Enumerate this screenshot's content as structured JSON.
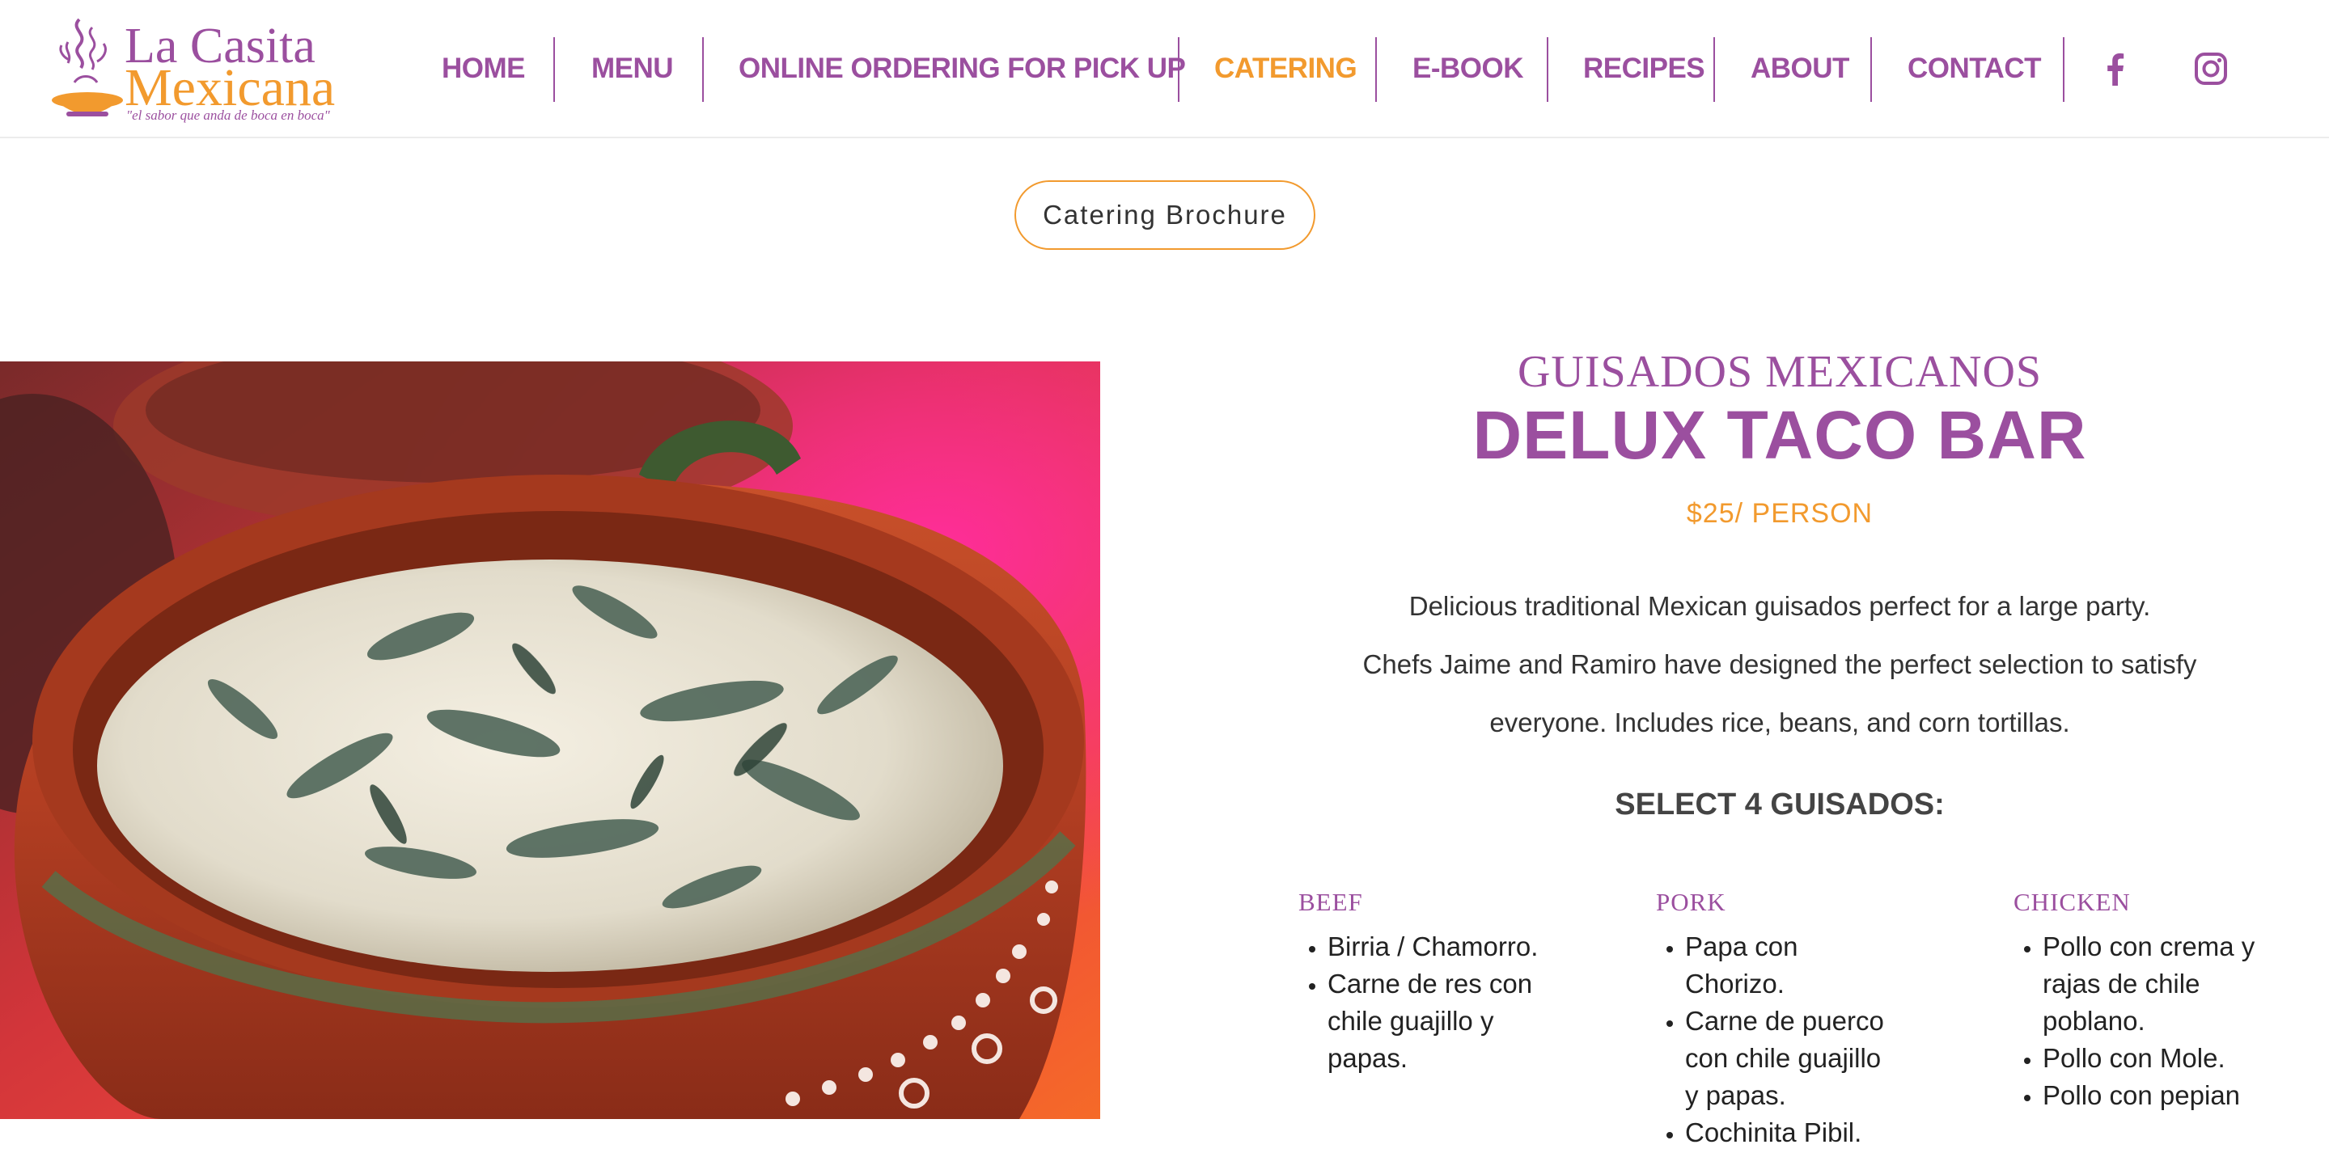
{
  "brand": {
    "name_line1": "La Casita",
    "name_line2": "Mexicana",
    "tagline": "\"el sabor que anda de boca en boca\"",
    "primary_color": "#9b4f9f",
    "accent_color": "#f29a2e"
  },
  "nav": {
    "items": [
      {
        "label": "HOME"
      },
      {
        "label": "MENU"
      },
      {
        "label": "ONLINE ORDERING FOR PICK UP"
      },
      {
        "label": "CATERING",
        "active": true
      },
      {
        "label": "E-BOOK"
      },
      {
        "label": "RECIPES"
      },
      {
        "label": "ABOUT"
      },
      {
        "label": "CONTACT"
      }
    ],
    "social": [
      "facebook-icon",
      "instagram-icon"
    ]
  },
  "brochure": {
    "label": "Catering Brochure"
  },
  "hero": {
    "image": "clay-bowl-rajas-con-crema-photo"
  },
  "package": {
    "subtitle": "GUISADOS MEXICANOS",
    "title": "DELUX TACO BAR",
    "price": "$25/ PERSON",
    "desc_line1": "Delicious traditional Mexican guisados perfect for a large party.",
    "desc_line2": "Chefs Jaime and Ramiro have designed the perfect selection to satisfy",
    "desc_line3": "everyone. Includes rice, beans, and corn tortillas.",
    "select_heading": "SELECT 4 GUISADOS:",
    "categories": [
      {
        "title": "BEEF",
        "items": [
          "Birria / Chamorro.",
          "Carne de res con chile guajillo y papas."
        ]
      },
      {
        "title": "PORK",
        "items": [
          "Papa con Chorizo.",
          "Carne de puerco con chile guajillo y papas.",
          "Cochinita Pibil."
        ]
      },
      {
        "title": "CHICKEN",
        "items": [
          "Pollo con crema y rajas de chile poblano.",
          "Pollo con Mole.",
          "Pollo con pepian"
        ]
      }
    ]
  }
}
